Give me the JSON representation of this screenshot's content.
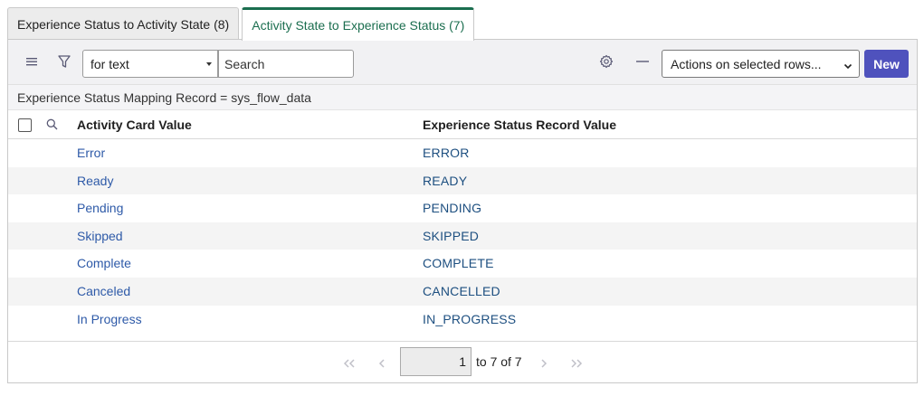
{
  "tabs": [
    {
      "label": "Experience Status to Activity State (8)",
      "active": false
    },
    {
      "label": "Activity State to Experience Status (7)",
      "active": true
    }
  ],
  "toolbar": {
    "menu_icon": "hamburger-icon",
    "filter_icon": "filter-icon",
    "search_field_value": "for text",
    "search_placeholder": "Search",
    "settings_icon": "gear-icon",
    "collapse_icon": "minus-icon",
    "actions_value": "Actions on selected rows...",
    "new_label": "New"
  },
  "breadcrumb": "Experience Status Mapping Record = sys_flow_data",
  "table": {
    "columns": [
      "Activity Card Value",
      "Experience Status Record Value"
    ],
    "rows": [
      {
        "activity": "Error",
        "status": "ERROR"
      },
      {
        "activity": "Ready",
        "status": "READY"
      },
      {
        "activity": "Pending",
        "status": "PENDING"
      },
      {
        "activity": "Skipped",
        "status": "SKIPPED"
      },
      {
        "activity": "Complete",
        "status": "COMPLETE"
      },
      {
        "activity": "Canceled",
        "status": "CANCELLED"
      },
      {
        "activity": "In Progress",
        "status": "IN_PROGRESS"
      }
    ]
  },
  "pagination": {
    "current_page": "1",
    "range_text": "to 7 of 7"
  },
  "colors": {
    "accent": "#1b6e4f",
    "primary_button": "#4f52bd",
    "link": "#2e5aa8"
  }
}
